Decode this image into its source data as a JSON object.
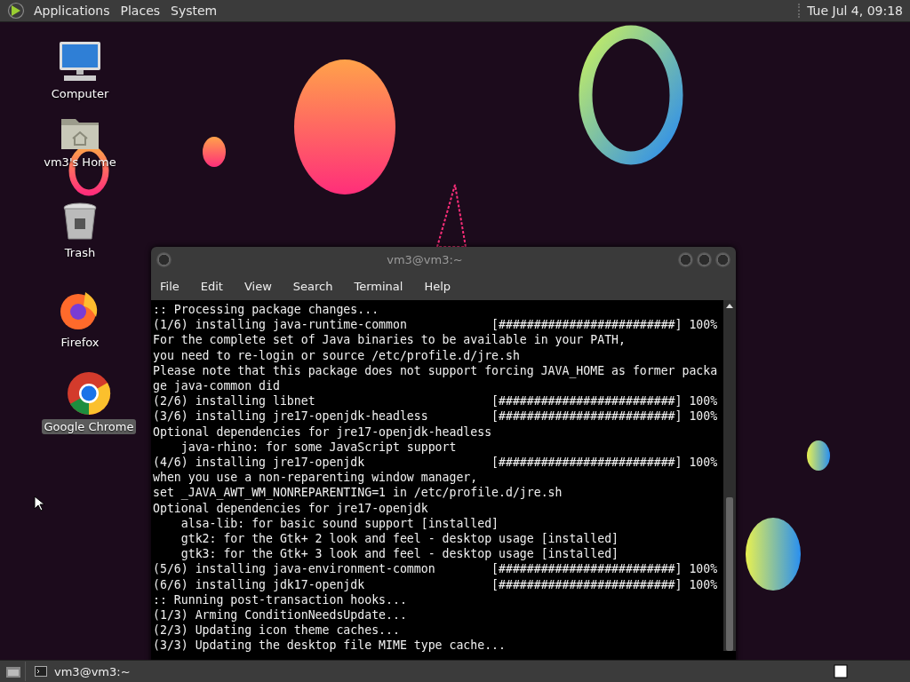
{
  "top_panel": {
    "menus": [
      "Applications",
      "Places",
      "System"
    ],
    "clock": "Tue Jul  4, 09:18"
  },
  "desktop_icons": [
    {
      "kind": "computer",
      "label": "Computer",
      "selected": false
    },
    {
      "kind": "home",
      "label": "vm3's Home",
      "selected": false
    },
    {
      "kind": "trash",
      "label": "Trash",
      "selected": false
    },
    {
      "kind": "firefox",
      "label": "Firefox",
      "selected": false
    },
    {
      "kind": "chrome",
      "label": "Google Chrome",
      "selected": true
    }
  ],
  "terminal": {
    "title": "vm3@vm3:~",
    "menu": [
      "File",
      "Edit",
      "View",
      "Search",
      "Terminal",
      "Help"
    ],
    "lines": [
      ":: Processing package changes...",
      "(1/6) installing java-runtime-common            [#########################] 100%",
      "For the complete set of Java binaries to be available in your PATH,",
      "you need to re-login or source /etc/profile.d/jre.sh",
      "Please note that this package does not support forcing JAVA_HOME as former packa",
      "ge java-common did",
      "(2/6) installing libnet                         [#########################] 100%",
      "(3/6) installing jre17-openjdk-headless         [#########################] 100%",
      "Optional dependencies for jre17-openjdk-headless",
      "    java-rhino: for some JavaScript support",
      "(4/6) installing jre17-openjdk                  [#########################] 100%",
      "when you use a non-reparenting window manager,",
      "set _JAVA_AWT_WM_NONREPARENTING=1 in /etc/profile.d/jre.sh",
      "Optional dependencies for jre17-openjdk",
      "    alsa-lib: for basic sound support [installed]",
      "    gtk2: for the Gtk+ 2 look and feel - desktop usage [installed]",
      "    gtk3: for the Gtk+ 3 look and feel - desktop usage [installed]",
      "(5/6) installing java-environment-common        [#########################] 100%",
      "(6/6) installing jdk17-openjdk                  [#########################] 100%",
      ":: Running post-transaction hooks...",
      "(1/3) Arming ConditionNeedsUpdate...",
      "(2/3) Updating icon theme caches...",
      "(3/3) Updating the desktop file MIME type cache..."
    ]
  },
  "taskbar": {
    "items": [
      {
        "label": "vm3@vm3:~"
      }
    ]
  }
}
